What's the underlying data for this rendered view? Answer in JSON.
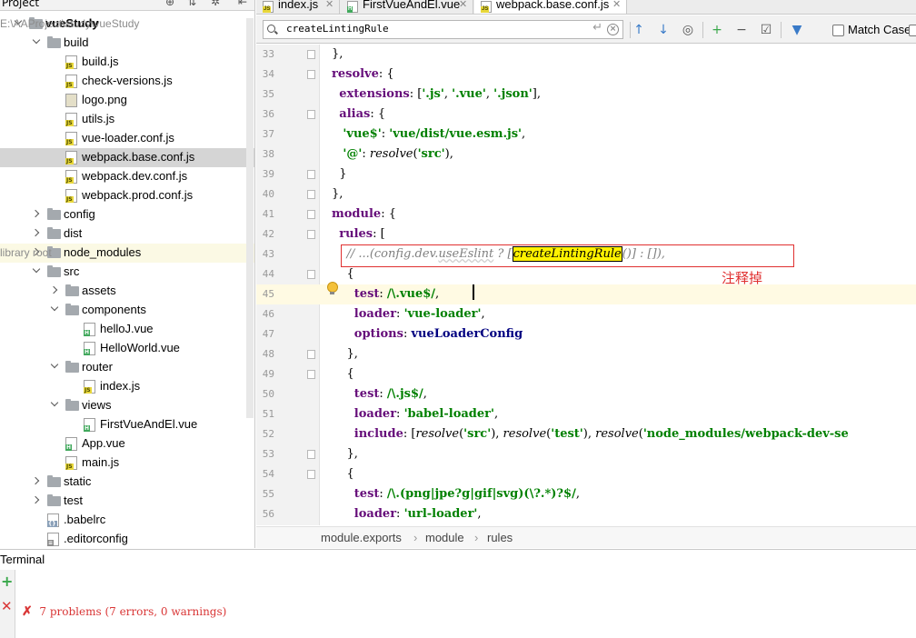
{
  "project_panel": {
    "title": "Project"
  },
  "tree": [
    {
      "label": "vueStudy",
      "hint": "E:\\AAProject\\study\\vueStudy",
      "type": "folder",
      "arrow": "down",
      "depth": 0,
      "bold": true
    },
    {
      "label": "build",
      "type": "folder",
      "arrow": "down",
      "depth": 1
    },
    {
      "label": "build.js",
      "type": "js",
      "depth": 2
    },
    {
      "label": "check-versions.js",
      "type": "js",
      "depth": 2
    },
    {
      "label": "logo.png",
      "type": "img",
      "depth": 2
    },
    {
      "label": "utils.js",
      "type": "js",
      "depth": 2
    },
    {
      "label": "vue-loader.conf.js",
      "type": "js",
      "depth": 2
    },
    {
      "label": "webpack.base.conf.js",
      "type": "js",
      "depth": 2,
      "selected": true
    },
    {
      "label": "webpack.dev.conf.js",
      "type": "js",
      "depth": 2
    },
    {
      "label": "webpack.prod.conf.js",
      "type": "js",
      "depth": 2
    },
    {
      "label": "config",
      "type": "folder",
      "arrow": "right",
      "depth": 1
    },
    {
      "label": "dist",
      "type": "folder",
      "arrow": "right",
      "depth": 1
    },
    {
      "label": "node_modules",
      "hint": "library root",
      "type": "folder",
      "arrow": "right",
      "depth": 1,
      "excluded": true
    },
    {
      "label": "src",
      "type": "folder",
      "arrow": "down",
      "depth": 1
    },
    {
      "label": "assets",
      "type": "folder",
      "arrow": "right",
      "depth": 2
    },
    {
      "label": "components",
      "type": "folder",
      "arrow": "down",
      "depth": 2
    },
    {
      "label": "helloJ.vue",
      "type": "vue",
      "depth": 3
    },
    {
      "label": "HelloWorld.vue",
      "type": "vue",
      "depth": 3
    },
    {
      "label": "router",
      "type": "folder",
      "arrow": "down",
      "depth": 2
    },
    {
      "label": "index.js",
      "type": "js",
      "depth": 3
    },
    {
      "label": "views",
      "type": "folder",
      "arrow": "down",
      "depth": 2
    },
    {
      "label": "FirstVueAndEl.vue",
      "type": "vue",
      "depth": 3
    },
    {
      "label": "App.vue",
      "type": "vue",
      "depth": 2
    },
    {
      "label": "main.js",
      "type": "js",
      "depth": 2
    },
    {
      "label": "static",
      "type": "folder",
      "arrow": "right",
      "depth": 1
    },
    {
      "label": "test",
      "type": "folder",
      "arrow": "right",
      "depth": 1
    },
    {
      "label": ".babelrc",
      "type": "cfg",
      "depth": 1
    },
    {
      "label": ".editorconfig",
      "type": "txt",
      "depth": 1
    }
  ],
  "tabs": [
    {
      "label": "index.js",
      "type": "js",
      "active": false
    },
    {
      "label": "FirstVueAndEl.vue",
      "type": "vue",
      "active": false
    },
    {
      "label": "webpack.base.conf.js",
      "type": "js",
      "active": true
    }
  ],
  "search": {
    "query": "createLintingRule",
    "match_case_label": "Match Case"
  },
  "editor": {
    "caret_line": 45,
    "highlighted_line": 43,
    "annotation": "注释掉",
    "lines": [
      {
        "n": "33",
        "fold": true,
        "tokens": [
          [
            "",
            "},"
          ]
        ]
      },
      {
        "n": "34",
        "fold": true,
        "tokens": [
          [
            "kp",
            "resolve"
          ],
          [
            "",
            ": {"
          ]
        ]
      },
      {
        "n": "35",
        "fold": false,
        "tokens": [
          [
            "",
            "  "
          ],
          [
            "kp",
            "extensions"
          ],
          [
            "",
            ": ["
          ],
          [
            "s",
            "'.js'"
          ],
          [
            "",
            ", "
          ],
          [
            "s",
            "'.vue'"
          ],
          [
            "",
            ", "
          ],
          [
            "s",
            "'.json'"
          ],
          [
            "",
            "],"
          ]
        ]
      },
      {
        "n": "36",
        "fold": true,
        "tokens": [
          [
            "",
            "  "
          ],
          [
            "kp",
            "alias"
          ],
          [
            "",
            ": {"
          ]
        ]
      },
      {
        "n": "37",
        "fold": false,
        "tokens": [
          [
            "",
            "   "
          ],
          [
            "s",
            "'vue$'"
          ],
          [
            "",
            ": "
          ],
          [
            "s",
            "'vue/dist/vue.esm.js'"
          ],
          [
            "",
            ","
          ]
        ]
      },
      {
        "n": "38",
        "fold": false,
        "tokens": [
          [
            "",
            "   "
          ],
          [
            "s",
            "'@'"
          ],
          [
            "",
            ": "
          ],
          [
            "fn",
            "resolve"
          ],
          [
            "",
            "("
          ],
          [
            "s",
            "'src'"
          ],
          [
            "",
            "),"
          ]
        ]
      },
      {
        "n": "39",
        "fold": true,
        "tokens": [
          [
            "",
            "  }"
          ]
        ]
      },
      {
        "n": "40",
        "fold": true,
        "tokens": [
          [
            "",
            "},"
          ]
        ]
      },
      {
        "n": "41",
        "fold": true,
        "tokens": [
          [
            "kp",
            "module"
          ],
          [
            "",
            ": {"
          ]
        ]
      },
      {
        "n": "42",
        "fold": true,
        "tokens": [
          [
            "",
            "  "
          ],
          [
            "kp",
            "rules"
          ],
          [
            "",
            ": ["
          ]
        ]
      },
      {
        "n": "43",
        "fold": false,
        "tokens": [
          [
            "cm",
            "    // ...(config.dev."
          ],
          [
            "cm wavy",
            "useEslint"
          ],
          [
            "cm",
            " ? ["
          ],
          [
            "hl fn",
            "createLintingRule"
          ],
          [
            "cm",
            "()] : []),"
          ]
        ]
      },
      {
        "n": "44",
        "fold": true,
        "tokens": [
          [
            "",
            "    {"
          ]
        ]
      },
      {
        "n": "45",
        "fold": false,
        "tokens": [
          [
            "",
            "      "
          ],
          [
            "kp",
            "test"
          ],
          [
            "",
            ": "
          ],
          [
            "re",
            "/\\.vue$/"
          ],
          [
            "",
            ","
          ]
        ]
      },
      {
        "n": "46",
        "fold": false,
        "tokens": [
          [
            "",
            "      "
          ],
          [
            "kp",
            "loader"
          ],
          [
            "",
            ": "
          ],
          [
            "s",
            "'vue-loader'"
          ],
          [
            "",
            ","
          ]
        ]
      },
      {
        "n": "47",
        "fold": false,
        "tokens": [
          [
            "",
            "      "
          ],
          [
            "kp",
            "options"
          ],
          [
            "",
            ": "
          ],
          [
            "k",
            "vueLoaderConfig"
          ]
        ]
      },
      {
        "n": "48",
        "fold": true,
        "tokens": [
          [
            "",
            "    },"
          ]
        ]
      },
      {
        "n": "49",
        "fold": true,
        "tokens": [
          [
            "",
            "    {"
          ]
        ]
      },
      {
        "n": "50",
        "fold": false,
        "tokens": [
          [
            "",
            "      "
          ],
          [
            "kp",
            "test"
          ],
          [
            "",
            ": "
          ],
          [
            "re",
            "/\\.js$/"
          ],
          [
            "",
            ","
          ]
        ]
      },
      {
        "n": "51",
        "fold": false,
        "tokens": [
          [
            "",
            "      "
          ],
          [
            "kp",
            "loader"
          ],
          [
            "",
            ": "
          ],
          [
            "s",
            "'babel-loader'"
          ],
          [
            "",
            ","
          ]
        ]
      },
      {
        "n": "52",
        "fold": false,
        "tokens": [
          [
            "",
            "      "
          ],
          [
            "kp",
            "include"
          ],
          [
            "",
            ": ["
          ],
          [
            "fn",
            "resolve"
          ],
          [
            "",
            "("
          ],
          [
            "s",
            "'src'"
          ],
          [
            "",
            "), "
          ],
          [
            "fn",
            "resolve"
          ],
          [
            "",
            "("
          ],
          [
            "s",
            "'test'"
          ],
          [
            "",
            "), "
          ],
          [
            "fn",
            "resolve"
          ],
          [
            "",
            "("
          ],
          [
            "s",
            "'node_modules/webpack-dev-se"
          ]
        ]
      },
      {
        "n": "53",
        "fold": true,
        "tokens": [
          [
            "",
            "    },"
          ]
        ]
      },
      {
        "n": "54",
        "fold": true,
        "tokens": [
          [
            "",
            "    {"
          ]
        ]
      },
      {
        "n": "55",
        "fold": false,
        "tokens": [
          [
            "",
            "      "
          ],
          [
            "kp",
            "test"
          ],
          [
            "",
            ": "
          ],
          [
            "re",
            "/\\.(png|jpe?g|gif|svg)(\\?.*)?$/"
          ],
          [
            "",
            ","
          ]
        ]
      },
      {
        "n": "56",
        "fold": false,
        "tokens": [
          [
            "",
            "      "
          ],
          [
            "kp",
            "loader"
          ],
          [
            "",
            ": "
          ],
          [
            "s",
            "'url-loader'"
          ],
          [
            "",
            ","
          ]
        ]
      }
    ]
  },
  "breadcrumb": [
    "module.exports",
    "module",
    "rules"
  ],
  "terminal": {
    "title": "Terminal",
    "output": "7 problems (7 errors, 0 warnings)",
    "error_mark": "✗"
  },
  "colors": {
    "annotation_red": "#e03030",
    "search_highlight": "#fff200",
    "caret_line": "#fffae3",
    "selected_row": "#d5d5d5"
  }
}
